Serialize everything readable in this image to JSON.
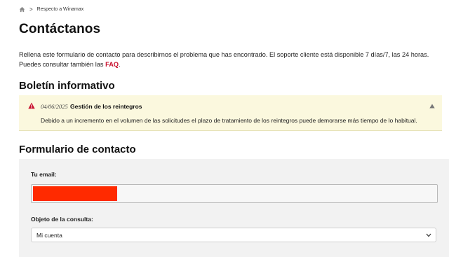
{
  "breadcrumb": {
    "separator": ">",
    "current": "Respecto a Winamax"
  },
  "page": {
    "title": "Contáctanos",
    "intro_text": "Rellena este formulario de contacto para describirnos el problema que has encontrado. El soporte cliente está disponible 7 días/7, las 24 horas. Puedes consultar también las ",
    "intro_link": "FAQ",
    "intro_end": "."
  },
  "newsletter": {
    "heading": "Boletín informativo",
    "notice": {
      "date": "04/06/2025",
      "title": "Gestión de los reintegros",
      "body": "Debido a un incremento en el volumen de las solicitudes el plazo de tratamiento de los reintegros puede demorarse más tiempo de lo habitual."
    }
  },
  "form": {
    "heading": "Formulario de contacto",
    "email_label": "Tu email:",
    "subject_label": "Objeto de la consulta:",
    "subject_value": "Mi cuenta"
  },
  "colors": {
    "accent": "#c8102e",
    "notice_bg": "#fbf8de",
    "redaction": "#ff2a00"
  }
}
